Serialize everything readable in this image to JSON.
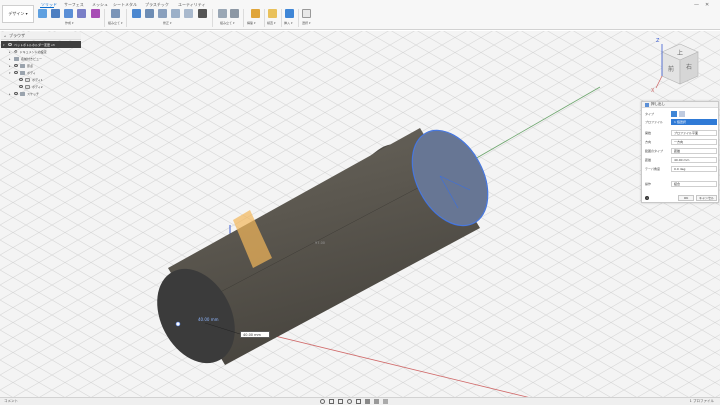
{
  "workspace": {
    "label": "デザイン ▾"
  },
  "tabs": [
    {
      "label": "ソリッド",
      "active": true
    },
    {
      "label": "サーフェス"
    },
    {
      "label": "メッシュ"
    },
    {
      "label": "シートメタル"
    },
    {
      "label": "プラスチック"
    },
    {
      "label": "ユーティリティ"
    }
  ],
  "groups": {
    "create": "作成 ▾",
    "modify": "修正 ▾",
    "assemble": "組み立て ▾",
    "construct": "構築 ▾",
    "inspect": "検査 ▾",
    "insert": "挿入 ▾",
    "select": "選択 ▾"
  },
  "browser": {
    "title": "ブラウザ",
    "document": "ペットボトルホルダー変更 v3",
    "items": [
      {
        "label": "ドキュメントの設定",
        "indent": 1
      },
      {
        "label": "名前付きビュー",
        "indent": 1
      },
      {
        "label": "原点",
        "indent": 1
      },
      {
        "label": "ボディ",
        "indent": 1
      },
      {
        "label": "ボディ1",
        "indent": 2
      },
      {
        "label": "ボディ2",
        "indent": 2
      },
      {
        "label": "スケッチ",
        "indent": 1
      }
    ]
  },
  "viewcube": {
    "top": "上",
    "front": "前",
    "right": "右",
    "axis_z": "Z",
    "axis_x": "X"
  },
  "dialog": {
    "title": "押し出し",
    "rows": [
      {
        "label": "タイプ",
        "value": ""
      },
      {
        "label": "プロファイル",
        "value": "1 個選択"
      },
      {
        "label": "開始",
        "value": "プロファイル平面"
      },
      {
        "label": "方向",
        "value": "一方向"
      },
      {
        "label": "範囲のタイプ",
        "value": "距離"
      },
      {
        "label": "距離",
        "value": "40.00 mm"
      },
      {
        "label": "テーパ角度",
        "value": "0.0 deg"
      },
      {
        "label": "操作",
        "value": "結合"
      }
    ],
    "ok": "OK",
    "cancel": "キャンセル"
  },
  "viewport": {
    "dimension_value": "40.00 mm",
    "length_label": "97.00"
  },
  "statusbar": {
    "left": "コメント",
    "right": "1 プロファイル"
  },
  "colors": {
    "accent": "#0a6ed1",
    "cylinder_side": "#5d5952",
    "cylinder_end": "#3b3b3b",
    "selection_face": "#7a9ad6",
    "preview": "#f0b860"
  }
}
